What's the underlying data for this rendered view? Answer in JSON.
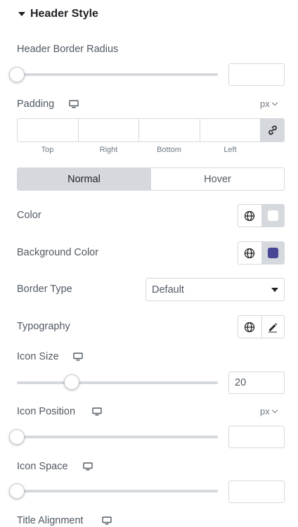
{
  "section": {
    "title": "Header Style"
  },
  "header_border_radius": {
    "label": "Header Border Radius",
    "value": "",
    "slider_level": 0
  },
  "padding": {
    "label": "Padding",
    "unit": "px",
    "values": [
      "",
      "",
      "",
      ""
    ],
    "sides": [
      "Top",
      "Right",
      "Bottom",
      "Left"
    ]
  },
  "state_tabs": {
    "items": [
      "Normal",
      "Hover"
    ],
    "active": "Normal"
  },
  "color": {
    "label": "Color",
    "swatch": "#ffffff"
  },
  "background_color": {
    "label": "Background Color",
    "swatch": "#4a4696"
  },
  "border_type": {
    "label": "Border Type",
    "value": "Default"
  },
  "typography": {
    "label": "Typography"
  },
  "icon_size": {
    "label": "Icon Size",
    "value": "20",
    "slider_level": 0.27
  },
  "icon_position": {
    "label": "Icon Position",
    "unit": "px",
    "value": "",
    "slider_level": 0
  },
  "icon_space": {
    "label": "Icon Space",
    "value": "",
    "slider_level": 0
  },
  "title_alignment": {
    "label": "Title Alignment"
  },
  "icons": {
    "responsive": "desktop-monitor-icon",
    "global": "globe-icon",
    "edit": "pencil-icon",
    "link": "link-icon",
    "section_toggle": "caret-down-icon"
  },
  "colors": {
    "accent_bg": "#d5d8dc",
    "text": "#515962",
    "title": "#1f2124"
  }
}
